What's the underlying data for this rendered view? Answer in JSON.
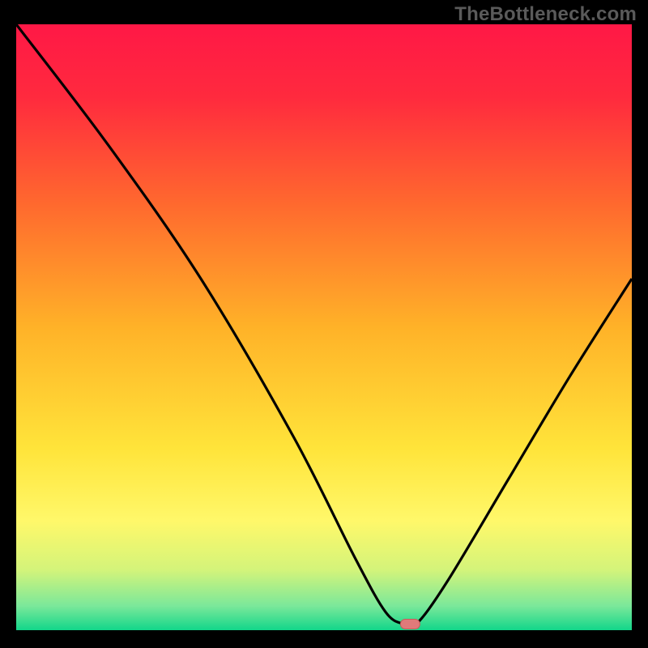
{
  "watermark": "TheBottleneck.com",
  "chart_data": {
    "type": "line",
    "title": "",
    "xlabel": "",
    "ylabel": "",
    "xlim": [
      0,
      100
    ],
    "ylim": [
      0,
      100
    ],
    "grid": false,
    "series": [
      {
        "name": "curve",
        "x": [
          0,
          15,
          30,
          45,
          55,
          60,
          63,
          65,
          70,
          80,
          90,
          100
        ],
        "y": [
          100,
          80,
          58,
          32,
          12,
          3,
          1,
          1,
          8,
          25,
          42,
          58
        ]
      }
    ],
    "marker": {
      "x": 64,
      "y": 1
    },
    "background_gradient": {
      "stops": [
        {
          "offset": 0.0,
          "color": "#ff1846"
        },
        {
          "offset": 0.12,
          "color": "#ff2a3e"
        },
        {
          "offset": 0.3,
          "color": "#ff6a2e"
        },
        {
          "offset": 0.5,
          "color": "#ffb228"
        },
        {
          "offset": 0.7,
          "color": "#ffe43a"
        },
        {
          "offset": 0.82,
          "color": "#fff86a"
        },
        {
          "offset": 0.9,
          "color": "#d4f47a"
        },
        {
          "offset": 0.96,
          "color": "#7be89a"
        },
        {
          "offset": 1.0,
          "color": "#12d68a"
        }
      ]
    },
    "colors": {
      "curve": "#000000",
      "marker_fill": "#e07a7a",
      "marker_stroke": "#c85a5a"
    }
  }
}
